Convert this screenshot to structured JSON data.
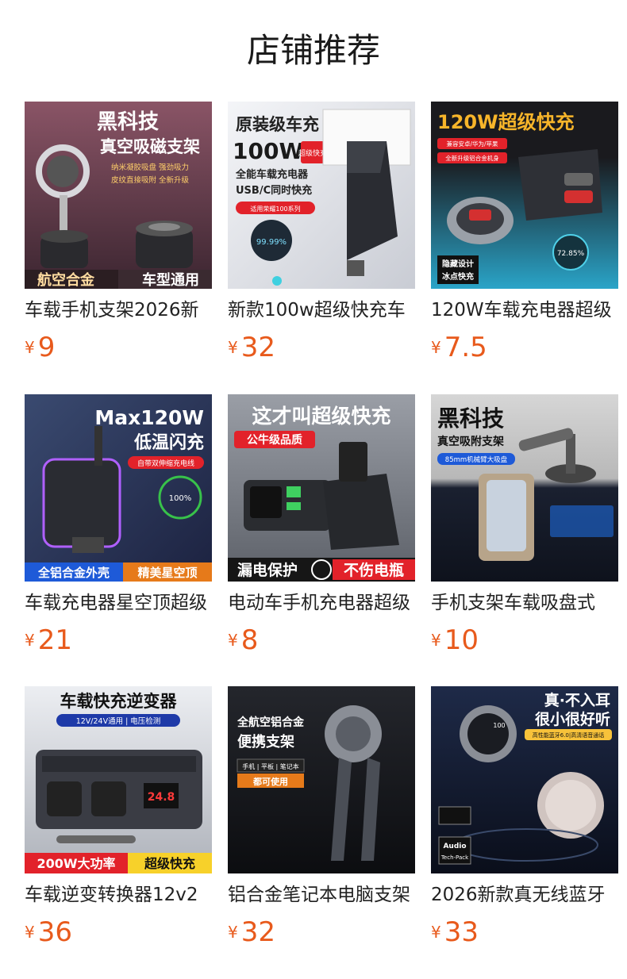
{
  "page": {
    "title": "店铺推荐"
  },
  "currency": "¥",
  "products": [
    {
      "name": "车载手机支架2026新",
      "price": "9",
      "image": {
        "headline": "黑科技",
        "sub": "真空吸磁支架",
        "tag1": "纳米凝胶吸盘 强劲吸力",
        "tag2": "皮纹直接吸附 全新升级",
        "bottom_left": "航空合金",
        "bottom_right": "车型通用"
      }
    },
    {
      "name": "新款100w超级快充车",
      "price": "32",
      "image": {
        "headline": "原装级车充",
        "power": "100W",
        "badge": "超级快充",
        "line1": "全能车载充电器",
        "line2": "USB/C同时快充",
        "chip": "适用荣耀100系列",
        "percent": "99.99%"
      }
    },
    {
      "name": "120W车载充电器超级",
      "price": "7.5",
      "image": {
        "headline": "120W超级快充",
        "chip1": "兼容安卓/华为/苹果",
        "chip2": "全新升级铝合金机身",
        "corner1": "隐藏设计",
        "corner2": "冰点快充",
        "percent": "72.85%"
      }
    },
    {
      "name": "车载充电器星空顶超级",
      "price": "21",
      "image": {
        "headline": "Max120W",
        "sub": "低温闪充",
        "chip": "自带双伸缩充电线",
        "percent": "100%",
        "bottom_left": "全铝合金外壳",
        "bottom_right": "精美星空顶"
      }
    },
    {
      "name": "电动车手机充电器超级",
      "price": "8",
      "image": {
        "headline": "这才叫超级快充",
        "chip": "公牛级品质",
        "bottom_left": "漏电保护",
        "bottom_right": "不伤电瓶"
      }
    },
    {
      "name": "手机支架车载吸盘式",
      "price": "10",
      "image": {
        "headline": "黑科技",
        "sub": "真空吸附支架",
        "chip": "85mm机械臂大吸盘"
      }
    },
    {
      "name": "车载逆变转换器12v2",
      "price": "36",
      "image": {
        "headline": "车载快充逆变器",
        "chip": "12V/24V通用 | 电压检测",
        "display": "24.8",
        "bottom_left": "200W大功率",
        "bottom_right": "超级快充"
      }
    },
    {
      "name": "铝合金笔记本电脑支架",
      "price": "32",
      "image": {
        "line1": "全航空铝合金",
        "line2": "便携支架",
        "chip": "手机 | 平板 | 笔记本",
        "chip2": "都可使用"
      }
    },
    {
      "name": "2026新款真无线蓝牙",
      "price": "33",
      "image": {
        "headline1": "真·不入耳",
        "headline2": "很小很好听",
        "chip": "高性能蓝牙6.0|高清语音通话",
        "badge": "Audio",
        "badge2": "Tech-Pack",
        "number": "100"
      }
    }
  ],
  "colors": {
    "price": "#e85a1c",
    "title": "#1a1a1a"
  }
}
